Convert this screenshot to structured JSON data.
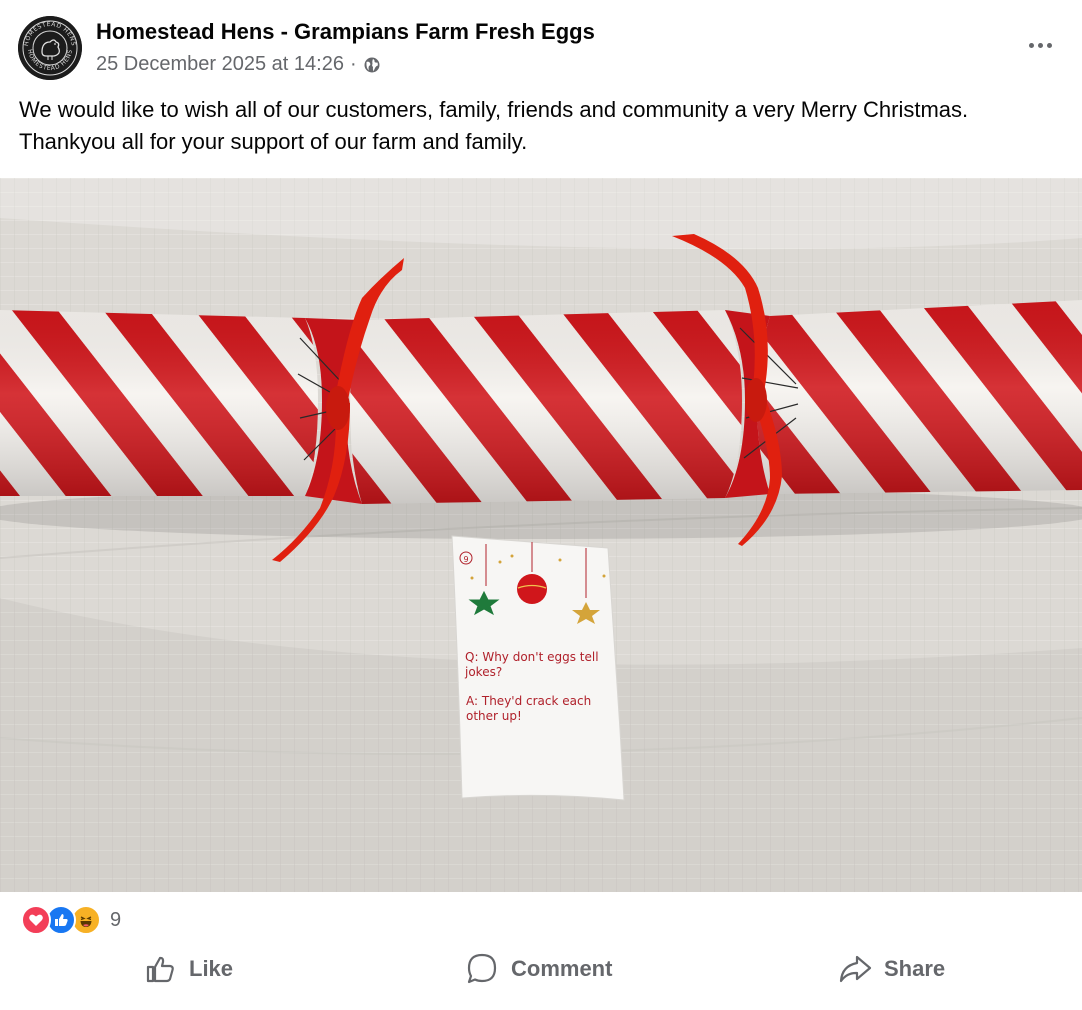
{
  "post": {
    "page_name": "Homestead Hens - Grampians Farm Fresh Eggs",
    "timestamp": "25 December 2025 at 14:26",
    "separator": "·",
    "visibility_icon": "globe-icon",
    "text": "We would like to wish all of our customers, family, friends and community a very Merry Christmas. Thankyou all for your support of our farm and family."
  },
  "avatar": {
    "logo_text": "HOMESTEAD HENS"
  },
  "photo": {
    "description_icon": "christmas-cracker-photo",
    "joke_card": {
      "number": "9",
      "question_marker": "Q:",
      "question": "Why don't eggs tell jokes?",
      "answer_marker": "A:",
      "answer": "They'd crack each other up!"
    }
  },
  "reactions": {
    "types": [
      "love",
      "like",
      "haha"
    ],
    "count": "9"
  },
  "actions": {
    "like_label": "Like",
    "comment_label": "Comment",
    "share_label": "Share"
  },
  "colors": {
    "text_primary": "#050505",
    "text_secondary": "#65676b",
    "cracker_red": "#d0161b",
    "love": "#f33e58",
    "like": "#1877f2",
    "haha": "#f7b125"
  }
}
